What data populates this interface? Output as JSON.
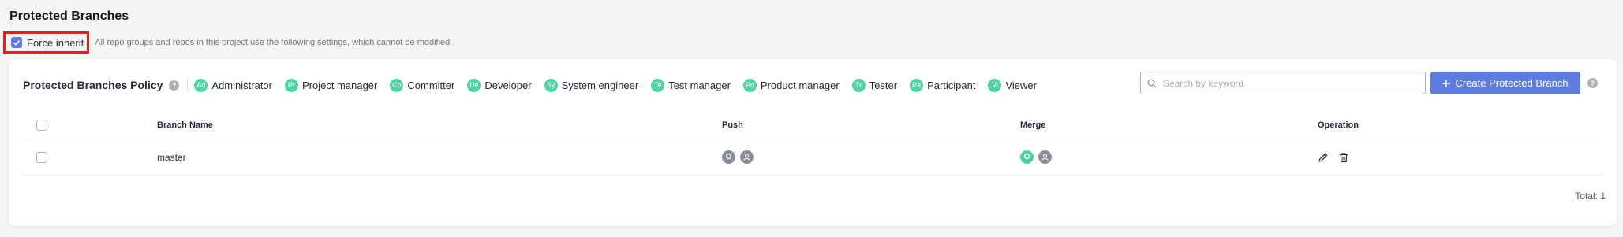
{
  "page": {
    "title": "Protected Branches",
    "force_inherit": {
      "label": "Force inherit",
      "checked": true,
      "hint": "All repo groups and repos in this project use the following settings, which cannot be modified ."
    }
  },
  "policy": {
    "title": "Protected Branches Policy",
    "help": "?",
    "roles": [
      {
        "abbr": "Ad",
        "label": "Administrator"
      },
      {
        "abbr": "Pr",
        "label": "Project manager"
      },
      {
        "abbr": "Co",
        "label": "Committer"
      },
      {
        "abbr": "De",
        "label": "Developer"
      },
      {
        "abbr": "Sy",
        "label": "System engineer"
      },
      {
        "abbr": "Te",
        "label": "Test manager"
      },
      {
        "abbr": "Pd",
        "label": "Product manager"
      },
      {
        "abbr": "Tr",
        "label": "Tester"
      },
      {
        "abbr": "Pa",
        "label": "Participant"
      },
      {
        "abbr": "Vi",
        "label": "Viewer"
      }
    ],
    "role_color": "#4fd2a4"
  },
  "search": {
    "placeholder": "Search by keyword.",
    "value": ""
  },
  "create_button": {
    "label": "Create Protected Branch",
    "icon": "plus-icon"
  },
  "create_help": "?",
  "table": {
    "headers": {
      "name": "Branch Name",
      "push": "Push",
      "merge": "Merge",
      "operation": "Operation"
    },
    "rows": [
      {
        "name": "master",
        "push": {
          "owner": "O",
          "owner_color": "#8a8e99",
          "member_icon": "user-icon"
        },
        "merge": {
          "owner": "O",
          "owner_color": "#4fd2a4",
          "member_icon": "user-icon"
        },
        "operations": [
          "edit-icon",
          "delete-icon"
        ]
      }
    ]
  },
  "total": "Total: 1",
  "colors": {
    "accent": "#5e7ce0",
    "highlight_border": "#e0201c"
  }
}
